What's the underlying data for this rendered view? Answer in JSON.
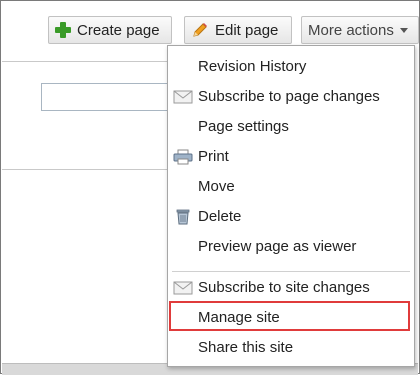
{
  "toolbar": {
    "create_label": "Create page",
    "edit_label": "Edit page",
    "more_label": "More actions"
  },
  "menu": {
    "items": [
      {
        "label": "Revision History",
        "icon": ""
      },
      {
        "label": "Subscribe to page changes",
        "icon": "envelope-icon"
      },
      {
        "label": "Page settings",
        "icon": ""
      },
      {
        "label": "Print",
        "icon": "printer-icon"
      },
      {
        "label": "Move",
        "icon": ""
      },
      {
        "label": "Delete",
        "icon": "trash-icon"
      },
      {
        "label": "Preview page as viewer",
        "icon": ""
      },
      {
        "label": "Subscribe to site changes",
        "icon": "envelope-icon"
      },
      {
        "label": "Manage site",
        "icon": ""
      },
      {
        "label": "Share this site",
        "icon": ""
      }
    ],
    "highlighted": "Manage site"
  },
  "colors": {
    "create_icon": "#3a9b28",
    "edit_icon": "#f0a020",
    "highlight_border": "#e03b3b"
  }
}
